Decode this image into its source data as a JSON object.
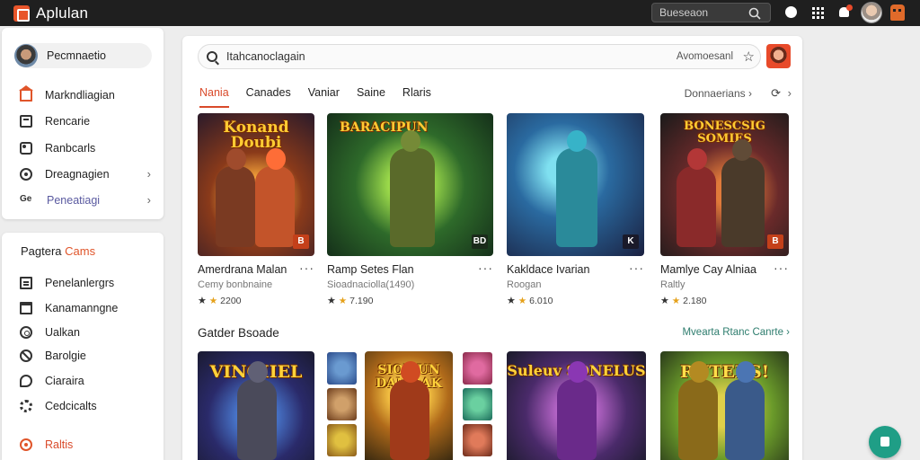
{
  "topbar": {
    "app_title": "Aplulan",
    "search_placeholder": "Bueseaon"
  },
  "sidebar": {
    "user_name": "Pecmnaetio",
    "items": [
      {
        "label": "Markndliagian",
        "icon": "home-icon"
      },
      {
        "label": "Rencarie",
        "icon": "inbox-icon"
      },
      {
        "label": "Ranbcarls",
        "icon": "tag-icon"
      },
      {
        "label": "Dreagnagien",
        "icon": "comment-icon",
        "has_chevron": true
      },
      {
        "label": "Peneatiagi",
        "icon_text": "Ge",
        "has_chevron": true
      }
    ],
    "section": {
      "title_prefix": "Pagtera",
      "title_accent": "Cams",
      "items": [
        {
          "label": "Penelanlergrs",
          "icon": "list-icon"
        },
        {
          "label": "Kanamanngne",
          "icon": "package-icon"
        },
        {
          "label": "Ualkan",
          "icon": "ring-icon"
        },
        {
          "label": "Barolgie",
          "icon": "ban-icon"
        },
        {
          "label": "Ciaraira",
          "icon": "bubble-icon"
        },
        {
          "label": "Cedcicalts",
          "icon": "cog-icon"
        },
        {
          "label": "Raltis",
          "icon": "settings-icon"
        }
      ]
    }
  },
  "main": {
    "search_value": "Itahcanoclagain",
    "filter_label": "Avomoesanl",
    "tabs": [
      "Nania",
      "Canades",
      "Vaniar",
      "Saine",
      "Rlaris"
    ],
    "tabs_right": "Donnaerians",
    "games": [
      {
        "thumb_title": "Konand Doubi",
        "badge": "B",
        "name": "Amerdrana Malan",
        "subtitle": "Cemy bonbnaine",
        "rating": "2200"
      },
      {
        "thumb_title": "BARACIPUN",
        "badge": "BD",
        "name": "Ramp Setes Flan",
        "subtitle": "Sioadnaciolla(1490)",
        "rating": "7.190"
      },
      {
        "thumb_title": "",
        "badge": "K",
        "name": "Kakldace Ivarian",
        "subtitle": "Roogan",
        "rating": "6.010"
      },
      {
        "thumb_title": "BONESCSIG SOMIES",
        "badge": "B",
        "name": "Mamlye Cay Alniaa",
        "subtitle": "Raltly",
        "rating": "2.180"
      }
    ],
    "section2_title": "Gatder Bsoade",
    "section2_link": "Mvearta Rtanc Canrte",
    "bottom_games": [
      {
        "title": "VINGIIEL"
      },
      {
        "title": "SIOMUN DAMOAK"
      },
      {
        "title": "Suleuv SONELUS"
      },
      {
        "title": "RUTEBS!"
      }
    ]
  },
  "colors": {
    "accent": "#d94a2a",
    "topbar": "#1f1f1f",
    "link": "#2e7d6e",
    "fab": "#1f9e86"
  }
}
